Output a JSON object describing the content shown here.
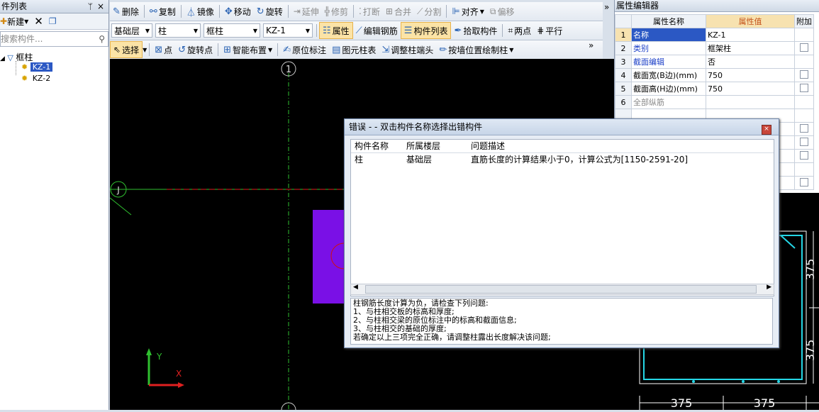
{
  "left_panel": {
    "title": "件列表",
    "pin": "ᛘ",
    "close": "×",
    "new_label": "新建",
    "search_placeholder": "搜索构件...",
    "tree": {
      "root": "框柱",
      "items": [
        "KZ-1",
        "KZ-2"
      ]
    }
  },
  "toolbar1": {
    "items": [
      "删除",
      "复制",
      "镜像",
      "移动",
      "旋转",
      "延伸",
      "修剪",
      "打断",
      "合并",
      "分割",
      "对齐",
      "偏移"
    ],
    "overflow": "»"
  },
  "toolbar2": {
    "floor": "基础层",
    "category": "柱",
    "type": "框柱",
    "component": "KZ-1",
    "buttons": [
      "属性",
      "编辑钢筋",
      "构件列表",
      "拾取构件",
      "两点",
      "平行"
    ]
  },
  "toolbar3": {
    "buttons": [
      "选择",
      "点",
      "旋转点",
      "智能布置",
      "原位标注",
      "图元柱表",
      "调整柱端头",
      "按墙位置绘制柱"
    ],
    "overflow": "»"
  },
  "canvas": {
    "axis_top": "1",
    "axis_left": "J",
    "axis_bottom": "1",
    "ucs_y": "Y",
    "ucs_x": "X",
    "colors": {
      "bg": "#000000",
      "axis_green": "#2fbf2f",
      "axis_red": "#e02020",
      "column": "#7a10e6"
    }
  },
  "property_editor": {
    "title": "属性编辑器",
    "headers": [
      "属性名称",
      "属性值",
      "附加"
    ],
    "rows": [
      {
        "num": "1",
        "name": "名称",
        "value": "KZ-1"
      },
      {
        "num": "2",
        "name": "类别",
        "value": "框架柱"
      },
      {
        "num": "3",
        "name": "截面编辑",
        "value": "否"
      },
      {
        "num": "4",
        "name": "截面宽(B边)(mm)",
        "value": "750"
      },
      {
        "num": "5",
        "name": "截面高(H边)(mm)",
        "value": "750"
      },
      {
        "num": "6",
        "name": "全部纵筋",
        "value": ""
      }
    ]
  },
  "section_view": {
    "dims": [
      "375",
      "375",
      "375",
      "375"
    ]
  },
  "dialog": {
    "title": "错误 - - 双击构件名称选择出错构件",
    "close": "×",
    "columns": [
      "构件名称",
      "所属楼层",
      "问题描述"
    ],
    "rows": [
      {
        "name": "柱",
        "floor": "基础层",
        "desc": "直筋长度的计算结果小于0，计算公式为[1150-2591-20]"
      }
    ],
    "message": [
      "柱钢筋长度计算为负，请检查下列问题:",
      "1、与柱相交板的标高和厚度;",
      "2、与柱相交梁的原位标注中的标高和截面信息;",
      "3、与柱相交的基础的厚度;",
      "若确定以上三项完全正确，请调整柱露出长度解决该问题;"
    ]
  }
}
